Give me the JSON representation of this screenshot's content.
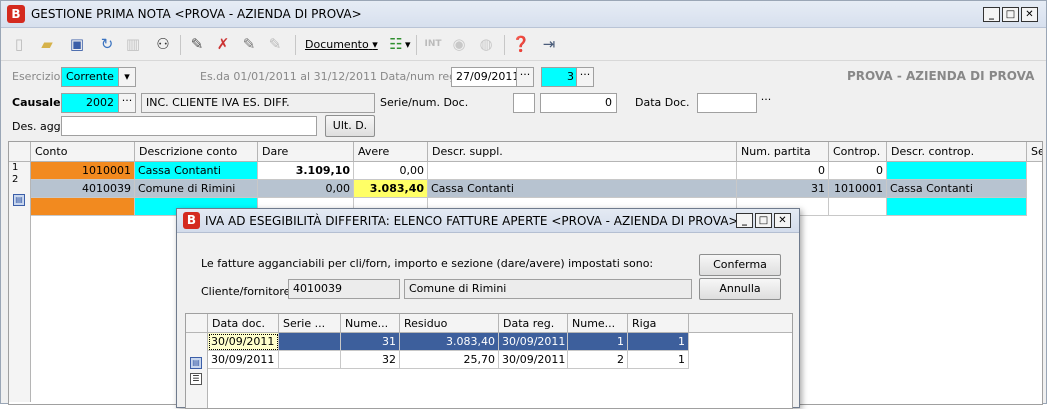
{
  "window": {
    "title": "GESTIONE PRIMA NOTA <PROVA - AZIENDA DI PROVA>",
    "app_icon": "B"
  },
  "toolbar": {
    "documento_label": "Documento",
    "int_label": "INT",
    "dropdown_arrow": "▾"
  },
  "header": {
    "esercizio_label": "Esercizio",
    "esercizio_value": "Corrente",
    "es_range": "Es.da 01/01/2011 al 31/12/2011",
    "datareg_label": "Data/num reg.",
    "datareg_value": "27/09/2011",
    "numreg_value": "3",
    "company": "PROVA - AZIENDA DI PROVA",
    "causale_label": "Causale",
    "causale_code": "2002",
    "causale_desc": "INC. CLIENTE IVA ES. DIFF.",
    "serie_label": "Serie/num. Doc.",
    "serie_value": "",
    "num_doc_value": "0",
    "data_doc_label": "Data Doc.",
    "data_doc_value": "",
    "des_agg_label": "Des. agg.",
    "des_agg_value": "",
    "ult_d_label": "Ult. D.",
    "ellipsis": "···"
  },
  "grid": {
    "columns": [
      "Conto",
      "Descrizione conto",
      "Dare",
      "Avere",
      "Descr. suppl.",
      "Num. partita",
      "Controp.",
      "Descr. controp.",
      "Se"
    ],
    "row_nums": [
      "1",
      "2"
    ],
    "rows": [
      [
        "1010001",
        "Cassa Contanti",
        "3.109,10",
        "0,00",
        "",
        "0",
        "0",
        ""
      ],
      [
        "4010039",
        "Comune di Rimini",
        "0,00",
        "3.083,40",
        "Cassa Contanti",
        "31",
        "1010001",
        "Cassa Contanti"
      ]
    ]
  },
  "dialog": {
    "title": "IVA AD ESEGIBILITÀ DIFFERITA: ELENCO FATTURE APERTE <PROVA - AZIENDA DI PROVA>",
    "info_text": "Le fatture agganciabili per cli/forn, importo e sezione (dare/avere) impostati sono:",
    "cliente_label": "Cliente/fornitore",
    "cliente_code": "4010039",
    "cliente_name": "Comune di Rimini",
    "conferma_label": "Conferma",
    "annulla_label": "Annulla",
    "columns": [
      "Data doc.",
      "Serie ...",
      "Nume...",
      "Residuo",
      "Data reg.",
      "Nume...",
      "Riga"
    ],
    "rows": [
      [
        "30/09/2011",
        "",
        "31",
        "3.083,40",
        "30/09/2011",
        "1",
        "1"
      ],
      [
        "30/09/2011",
        "",
        "32",
        "25,70",
        "30/09/2011",
        "2",
        "1"
      ]
    ]
  },
  "icons": {
    "new": "new-document-icon",
    "open": "open-folder-icon",
    "save": "save-icon",
    "undo": "undo-icon",
    "delete": "delete-icon",
    "find": "binoculars-icon",
    "help": "help-icon",
    "exit": "exit-door-icon"
  }
}
